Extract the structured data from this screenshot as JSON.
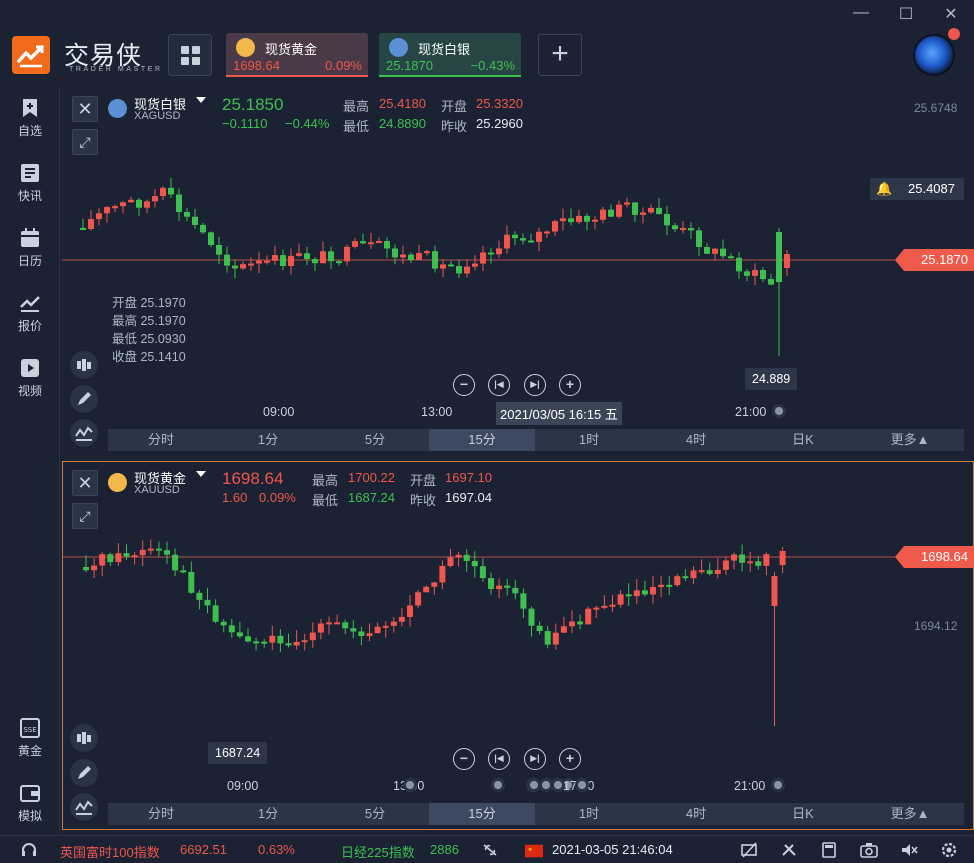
{
  "app": {
    "brand": "交易侠",
    "brand_sub": "TRADER MASTER"
  },
  "tabs": [
    {
      "name": "现货黄金",
      "price": "1698.64",
      "change": "0.09%"
    },
    {
      "name": "现货白银",
      "price": "25.1870",
      "change": "−0.43%"
    }
  ],
  "sidebar": {
    "items": [
      {
        "label": "自选",
        "icon": "bookmark-plus-icon"
      },
      {
        "label": "快讯",
        "icon": "news-list-icon"
      },
      {
        "label": "日历",
        "icon": "calendar-icon"
      },
      {
        "label": "报价",
        "icon": "trend-line-icon"
      },
      {
        "label": "视频",
        "icon": "play-icon"
      },
      {
        "label": "黄金",
        "icon": "sse-gold-icon"
      },
      {
        "label": "模拟",
        "icon": "wallet-icon"
      }
    ]
  },
  "top_chart": {
    "name": "现货白银",
    "code": "XAGUSD",
    "price": "25.1850",
    "change": "−0.1110",
    "change_pct": "−0.44%",
    "high_label": "最高",
    "high": "25.4180",
    "open_label": "开盘",
    "open": "25.3320",
    "low_label": "最低",
    "low": "24.8890",
    "prev_label": "昨收",
    "prev": "25.2960",
    "axis_top": "25.6748",
    "alert_price": "25.4087",
    "last_price_tag": "25.1870",
    "hover": {
      "open": "开盘 25.1970",
      "high": "最高 25.1970",
      "low": "最低 25.0930",
      "close": "收盘 25.1410"
    },
    "low_callout": "24.889",
    "time_labels": [
      "09:00",
      "13:00",
      "21:00"
    ],
    "crosshair_date": "2021/03/05 16:15 五"
  },
  "bottom_chart": {
    "name": "现货黄金",
    "code": "XAUUSD",
    "price": "1698.64",
    "change": "1.60",
    "change_pct": "0.09%",
    "high_label": "最高",
    "high": "1700.22",
    "open_label": "开盘",
    "open": "1697.10",
    "low_label": "最低",
    "low": "1687.24",
    "prev_label": "昨收",
    "prev": "1697.04",
    "last_price_tag": "1698.64",
    "axis_mid": "1694.12",
    "low_callout": "1687.24",
    "time_labels": [
      "09:00",
      "13:00",
      "17:00",
      "21:00"
    ]
  },
  "timeframes": [
    "分时",
    "1分",
    "5分",
    "15分",
    "1时",
    "4时",
    "日K",
    "更多▲"
  ],
  "active_timeframe": "15分",
  "statusbar": {
    "index1_name": "英国富时100指数",
    "index1_value": "6692.51",
    "index1_change": "0.63%",
    "index2_name": "日经225指数",
    "index2_value": "2886",
    "datetime": "2021-03-05 21:46:04"
  },
  "colors": {
    "up": "#f0564d",
    "down": "#3fbf4f",
    "accent": "#f26a1b",
    "background": "#1a2233"
  }
}
